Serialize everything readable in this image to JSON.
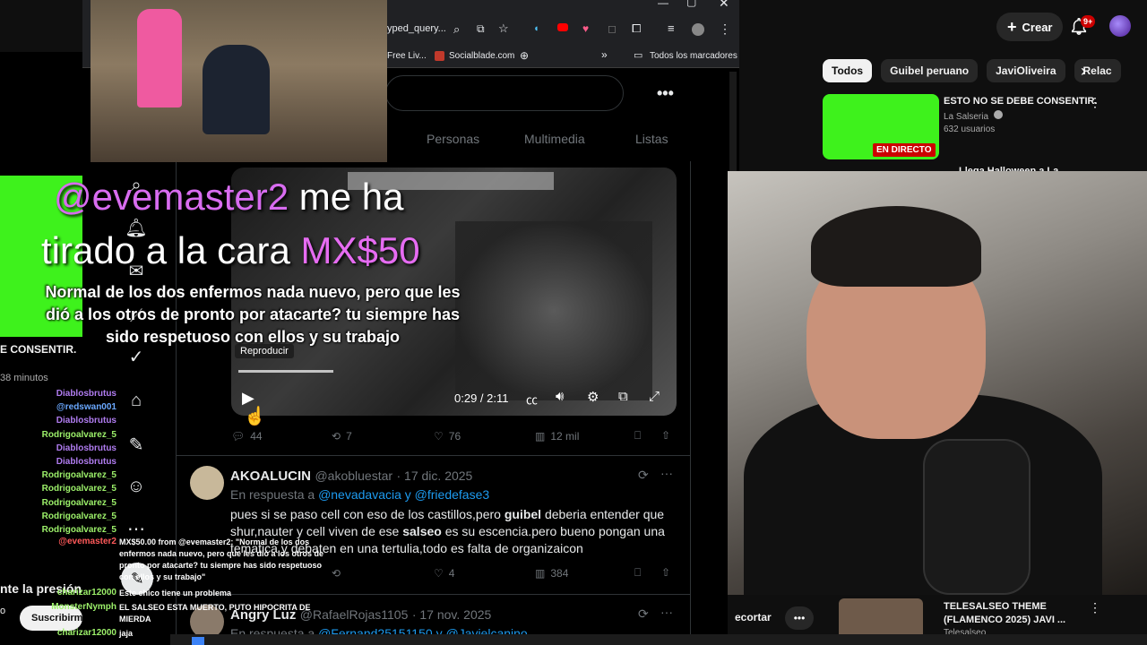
{
  "youtube": {
    "create_label": "Crear",
    "notification_count": "9+",
    "chips": [
      "Todos",
      "Guibel peruano",
      "JaviOliveira",
      "Relac"
    ],
    "rec1": {
      "title": "ESTO NO SE DEBE CONSENTIR.",
      "channel": "La Salseria",
      "meta": "632 usuarios",
      "live": "EN DIRECTO"
    },
    "rec2_title": "Llega Halloween a La",
    "bottom_rec": {
      "title_line1": "TELESALSEO THEME",
      "title_line2": "(FLAMENCO 2025)  JAVI ...",
      "channel": "Telesalseo"
    },
    "recortar": "ecortar",
    "subscribe": "Suscribirm",
    "left_title": "E CONSENTIR.",
    "left_time": "38 minutos",
    "left_presion": "nte la presión",
    "left_o": "o"
  },
  "browser": {
    "url": "yped_query...",
    "bookmarks": [
      "Free Liv...",
      "Socialblade.com",
      "Todos los marcadores"
    ]
  },
  "twitter": {
    "tabs": [
      "Personas",
      "Multimedia",
      "Listas"
    ],
    "video": {
      "time": "0:29 / 2:11",
      "tooltip": "Reproducir",
      "progress": 0.22
    },
    "tweet1_stats": {
      "replies": "44",
      "retweets": "7",
      "likes": "76",
      "views": "12 mil"
    },
    "tweet2": {
      "name": "AKOALUCIN",
      "handle": "@akobluestar",
      "date": "· 17 dic. 2025",
      "reply_prefix": "En respuesta a",
      "reply_user1": "@nevadavacia",
      "reply_and": "y",
      "reply_user2": "@friedefase3",
      "body_line1_a": "pues si se paso cell con eso de los castillos,pero ",
      "body_line1_b": "guibel",
      "body_line1_c": " deberia entender que",
      "body_line2_a": "shur,nauter y cell viven de ese ",
      "body_line2_b": "salseo",
      "body_line2_c": " es su escencia.pero bueno pongan una",
      "body_line3": "tematica y debaten en una tertulia,todo es falta de organizaicon",
      "retweets": "",
      "likes": "4",
      "views": "384"
    },
    "tweet3": {
      "name": "Angry Luz",
      "handle": "@RafaelRojas1105",
      "date": "· 17 nov. 2025",
      "reply_prefix": "En respuesta a",
      "reply_user1": "@Fernand25151150",
      "reply_and": "y",
      "reply_user2": "@Javielcanino"
    }
  },
  "donation": {
    "user": "@evemaster2",
    "text1": " me ha",
    "text2": "tirado a la cara ",
    "amount": "MX$50",
    "message_line1": "Normal de los dos enfermos nada nuevo, pero que les",
    "message_line2": "dió a los otros de pronto por atacarte? tu siempre has",
    "message_line3": "sido respetuoso con ellos y su trabajo"
  },
  "chat": {
    "users": [
      {
        "name": "Diablosbrutus",
        "color": "#b07cf0"
      },
      {
        "name": "@redswan001",
        "color": "#6aa8ff"
      },
      {
        "name": "Diablosbrutus",
        "color": "#b07cf0"
      },
      {
        "name": "Rodrigoalvarez_5",
        "color": "#9cf06a"
      },
      {
        "name": "Diablosbrutus",
        "color": "#b07cf0"
      },
      {
        "name": "Diablosbrutus",
        "color": "#b07cf0"
      },
      {
        "name": "Rodrigoalvarez_5",
        "color": "#9cf06a"
      },
      {
        "name": "Rodrigoalvarez_5",
        "color": "#9cf06a"
      },
      {
        "name": "Rodrigoalvarez_5",
        "color": "#9cf06a"
      },
      {
        "name": "Rodrigoalvarez_5",
        "color": "#9cf06a"
      },
      {
        "name": "Rodrigoalvarez_5",
        "color": "#9cf06a"
      }
    ],
    "donor": "@evemaster2",
    "donor_msg": [
      "MX$50.00 from @evemaster2: \"Normal de los dos",
      "enfermos nada nuevo, pero que les dió a los otros de",
      "pronto por atacarte? tu siempre has sido respetuoso",
      "con ellos y su trabajo\""
    ],
    "line_charizar1": "charizar12000",
    "msg_problem": "Este chico tiene un problema",
    "line_nymph": "MonsterNymph",
    "msg_salseo": [
      "EL SALSEO ESTA MUERTO, PUTO HIPOCRITA DE",
      "MIERDA"
    ],
    "line_charizar2": "charizar12000",
    "msg_jaja": "jaja"
  }
}
